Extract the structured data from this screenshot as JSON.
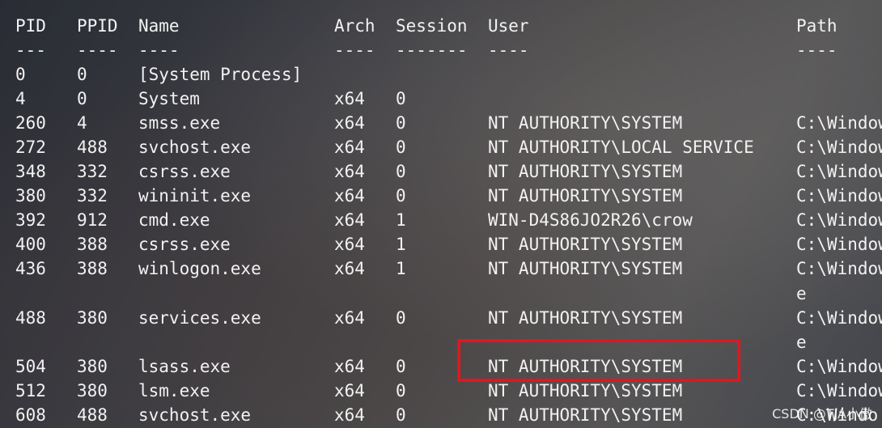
{
  "headers": {
    "pid": "PID",
    "ppid": "PPID",
    "name": "Name",
    "arch": "Arch",
    "session": "Session",
    "user": "User",
    "path": "Path"
  },
  "separators": {
    "pid": "---",
    "ppid": "----",
    "name": "----",
    "arch": "----",
    "session": "-------",
    "user": "----",
    "path": "----"
  },
  "rows": [
    {
      "pid": "0",
      "ppid": "0",
      "name": "[System Process]",
      "arch": "",
      "session": "",
      "user": "",
      "path": "",
      "path_cont": ""
    },
    {
      "pid": "4",
      "ppid": "0",
      "name": "System",
      "arch": "x64",
      "session": "0",
      "user": "",
      "path": "",
      "path_cont": ""
    },
    {
      "pid": "260",
      "ppid": "4",
      "name": "smss.exe",
      "arch": "x64",
      "session": "0",
      "user": "NT AUTHORITY\\SYSTEM",
      "path": "C:\\Window",
      "path_cont": ""
    },
    {
      "pid": "272",
      "ppid": "488",
      "name": "svchost.exe",
      "arch": "x64",
      "session": "0",
      "user": "NT AUTHORITY\\LOCAL SERVICE",
      "path": "C:\\Window",
      "path_cont": ""
    },
    {
      "pid": "348",
      "ppid": "332",
      "name": "csrss.exe",
      "arch": "x64",
      "session": "0",
      "user": "NT AUTHORITY\\SYSTEM",
      "path": "C:\\Window",
      "path_cont": ""
    },
    {
      "pid": "380",
      "ppid": "332",
      "name": "wininit.exe",
      "arch": "x64",
      "session": "0",
      "user": "NT AUTHORITY\\SYSTEM",
      "path": "C:\\Window",
      "path_cont": ""
    },
    {
      "pid": "392",
      "ppid": "912",
      "name": "cmd.exe",
      "arch": "x64",
      "session": "1",
      "user": "WIN-D4S86JO2R26\\crow",
      "path": "C:\\Window",
      "path_cont": ""
    },
    {
      "pid": "400",
      "ppid": "388",
      "name": "csrss.exe",
      "arch": "x64",
      "session": "1",
      "user": "NT AUTHORITY\\SYSTEM",
      "path": "C:\\Window",
      "path_cont": ""
    },
    {
      "pid": "436",
      "ppid": "388",
      "name": "winlogon.exe",
      "arch": "x64",
      "session": "1",
      "user": "NT AUTHORITY\\SYSTEM",
      "path": "C:\\Window",
      "path_cont": "e"
    },
    {
      "pid": "488",
      "ppid": "380",
      "name": "services.exe",
      "arch": "x64",
      "session": "0",
      "user": "NT AUTHORITY\\SYSTEM",
      "path": "C:\\Window",
      "path_cont": "e"
    },
    {
      "pid": "504",
      "ppid": "380",
      "name": "lsass.exe",
      "arch": "x64",
      "session": "0",
      "user": "NT AUTHORITY\\SYSTEM",
      "path": "C:\\Window",
      "path_cont": ""
    },
    {
      "pid": "512",
      "ppid": "380",
      "name": "lsm.exe",
      "arch": "x64",
      "session": "0",
      "user": "NT AUTHORITY\\SYSTEM",
      "path": "C:\\Window",
      "path_cont": ""
    },
    {
      "pid": "608",
      "ppid": "488",
      "name": "svchost.exe",
      "arch": "x64",
      "session": "0",
      "user": "NT AUTHORITY\\SYSTEM",
      "path": "C:\\Windo",
      "path_cont": ""
    }
  ],
  "watermark": "CSDN @TJA小傲",
  "colors": {
    "text": "#f2f2f2",
    "highlight": "#e2161e"
  }
}
